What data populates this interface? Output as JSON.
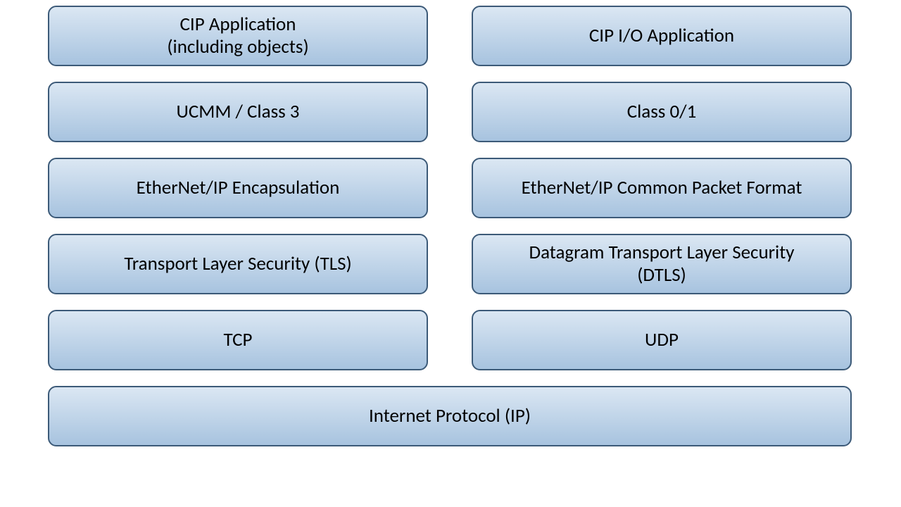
{
  "diagram": {
    "left": {
      "l1_a": "CIP Application",
      "l1_b": "(including objects)",
      "l2": "UCMM / Class 3",
      "l3": "EtherNet/IP Encapsulation",
      "l4": "Transport Layer Security (TLS)",
      "l5": "TCP"
    },
    "right": {
      "l1": "CIP I/O Application",
      "l2": "Class 0/1",
      "l3": "EtherNet/IP Common Packet Format",
      "l4_a": "Datagram Transport Layer Security",
      "l4_b": "(DTLS)",
      "l5": "UDP"
    },
    "bottom": "Internet Protocol (IP)"
  }
}
